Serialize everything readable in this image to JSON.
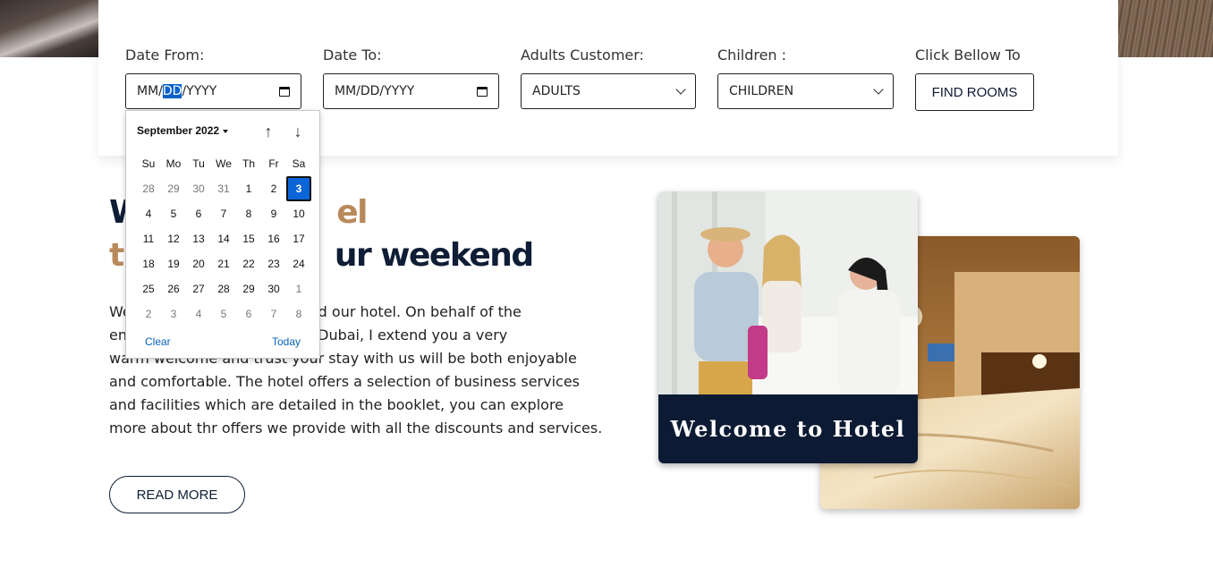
{
  "booking": {
    "date_from": {
      "label": "Date From:",
      "value": {
        "mm": "MM/",
        "dd": "DD",
        "yyyy": "/YYYY"
      }
    },
    "date_to": {
      "label": "Date To:",
      "value": "MM/DD/YYYY"
    },
    "adults": {
      "label": "Adults Customer:",
      "value": "ADULTS"
    },
    "children": {
      "label": "Children :",
      "value": "CHILDREN"
    },
    "find": {
      "label": "Click Bellow To",
      "button": "FIND ROOMS"
    }
  },
  "calendar": {
    "month_label": "September 2022",
    "weekdays": [
      "Su",
      "Mo",
      "Tu",
      "We",
      "Th",
      "Fr",
      "Sa"
    ],
    "weeks": [
      [
        {
          "d": "28",
          "m": true
        },
        {
          "d": "29",
          "m": true
        },
        {
          "d": "30",
          "m": true
        },
        {
          "d": "31",
          "m": true
        },
        {
          "d": "1"
        },
        {
          "d": "2"
        },
        {
          "d": "3",
          "s": true
        }
      ],
      [
        {
          "d": "4"
        },
        {
          "d": "5"
        },
        {
          "d": "6"
        },
        {
          "d": "7"
        },
        {
          "d": "8"
        },
        {
          "d": "9"
        },
        {
          "d": "10"
        }
      ],
      [
        {
          "d": "11"
        },
        {
          "d": "12"
        },
        {
          "d": "13"
        },
        {
          "d": "14"
        },
        {
          "d": "15"
        },
        {
          "d": "16"
        },
        {
          "d": "17"
        }
      ],
      [
        {
          "d": "18"
        },
        {
          "d": "19"
        },
        {
          "d": "20"
        },
        {
          "d": "21"
        },
        {
          "d": "22"
        },
        {
          "d": "23"
        },
        {
          "d": "24"
        }
      ],
      [
        {
          "d": "25"
        },
        {
          "d": "26"
        },
        {
          "d": "27"
        },
        {
          "d": "28"
        },
        {
          "d": "29"
        },
        {
          "d": "30"
        },
        {
          "d": "1",
          "m": true
        }
      ],
      [
        {
          "d": "2",
          "m": true
        },
        {
          "d": "3",
          "m": true
        },
        {
          "d": "4",
          "m": true
        },
        {
          "d": "5",
          "m": true
        },
        {
          "d": "6",
          "m": true
        },
        {
          "d": "7",
          "m": true
        },
        {
          "d": "8",
          "m": true
        }
      ]
    ],
    "clear_label": "Clear",
    "today_label": "Today"
  },
  "intro": {
    "heading_line1_a": "W",
    "heading_line1_accent": "el",
    "heading_line2_accent": "th",
    "heading_line2_b": "ur weekend",
    "paragraph_lines": [
      "We                         ve selected our hotel. On behalf of the",
      "en                       -Downtown-Dubai, I extend you a very",
      "warm welcome and trust your stay with us will be both enjoyable",
      "and comfortable. The hotel offers a selection of business services",
      "and facilities which are detailed in the booklet, you can explore",
      "more about thr offers we provide with all the discounts and services."
    ],
    "read_more": "READ MORE"
  },
  "images": {
    "banner_text": "Welcome to Hotel"
  },
  "colors": {
    "navy": "#0d1a33",
    "accent": "#b8895a",
    "selected": "#0a66d8"
  }
}
